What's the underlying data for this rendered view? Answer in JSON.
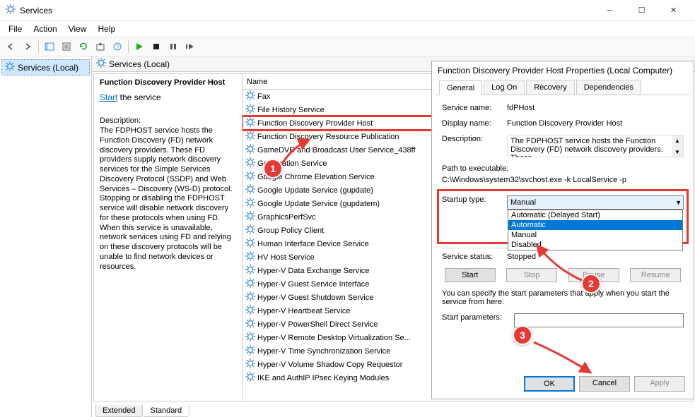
{
  "window": {
    "title": "Services"
  },
  "menu": {
    "file": "File",
    "action": "Action",
    "view": "View",
    "help": "Help"
  },
  "tree": {
    "root": "Services (Local)"
  },
  "header": {
    "title": "Services (Local)"
  },
  "columns": {
    "name": "Name"
  },
  "detail": {
    "selected_name": "Function Discovery Provider Host",
    "start_link": "Start",
    "start_suffix": " the service",
    "desc_label": "Description:",
    "desc_text": "The FDPHOST service hosts the Function Discovery (FD) network discovery providers. These FD providers supply network discovery services for the Simple Services Discovery Protocol (SSDP) and Web Services – Discovery (WS-D) protocol. Stopping or disabling the FDPHOST service will disable network discovery for these protocols when using FD. When this service is unavailable, network services using FD and relying on these discovery protocols will be unable to find network devices or resources."
  },
  "services": [
    "Fax",
    "File History Service",
    "Function Discovery Provider Host",
    "Function Discovery Resource Publication",
    "GameDVR and Broadcast User Service_438ff",
    "Geolocation Service",
    "Google Chrome Elevation Service",
    "Google Update Service (gupdate)",
    "Google Update Service (gupdatem)",
    "GraphicsPerfSvc",
    "Group Policy Client",
    "Human Interface Device Service",
    "HV Host Service",
    "Hyper-V Data Exchange Service",
    "Hyper-V Guest Service Interface",
    "Hyper-V Guest Shutdown Service",
    "Hyper-V Heartbeat Service",
    "Hyper-V PowerShell Direct Service",
    "Hyper-V Remote Desktop Virtualization Se...",
    "Hyper-V Time Synchronization Service",
    "Hyper-V Volume Shadow Copy Requestor",
    "IKE and AuthIP IPsec Keying Modules"
  ],
  "highlighted_index": 2,
  "tabs": {
    "extended": "Extended",
    "standard": "Standard"
  },
  "props": {
    "title": "Function Discovery Provider Host Properties (Local Computer)",
    "tabs": {
      "general": "General",
      "logon": "Log On",
      "recovery": "Recovery",
      "dependencies": "Dependencies"
    },
    "labels": {
      "service_name": "Service name:",
      "display_name": "Display name:",
      "description": "Description:",
      "path": "Path to executable:",
      "startup": "Startup type:",
      "status": "Service status:",
      "params_hint": "You can specify the start parameters that apply when you start the service from here.",
      "start_params": "Start parameters:"
    },
    "values": {
      "service_name": "fdPHost",
      "display_name": "Function Discovery Provider Host",
      "description": "The FDPHOST service hosts the Function Discovery (FD) network discovery providers. These",
      "path": "C:\\Windows\\system32\\svchost.exe -k LocalService -p",
      "startup_selected": "Manual",
      "status": "Stopped"
    },
    "dropdown": [
      "Automatic (Delayed Start)",
      "Automatic",
      "Manual",
      "Disabled"
    ],
    "dropdown_selected_index": 1,
    "buttons": {
      "start": "Start",
      "stop": "Stop",
      "pause": "Pause",
      "resume": "Resume",
      "ok": "OK",
      "cancel": "Cancel",
      "apply": "Apply"
    }
  },
  "annotations": {
    "a1": "1",
    "a2": "2",
    "a3": "3"
  }
}
